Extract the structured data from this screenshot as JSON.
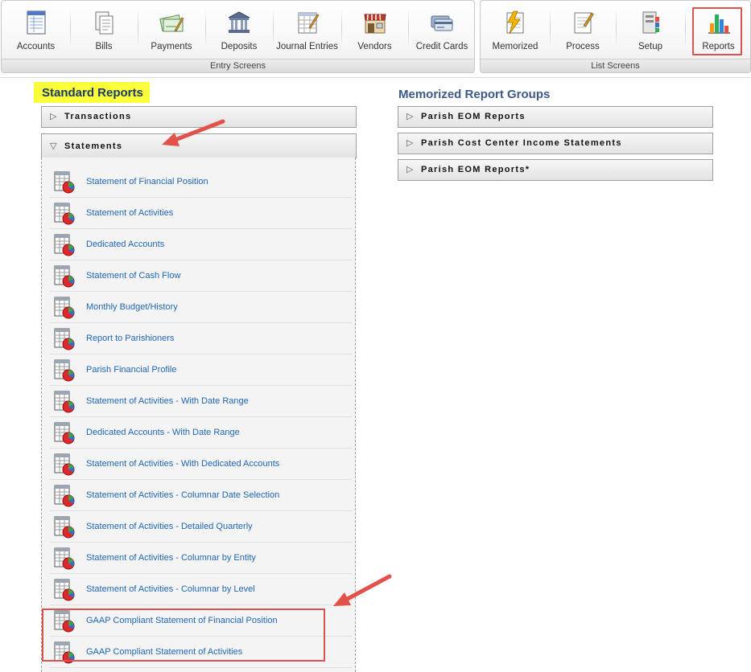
{
  "toolbar": {
    "entry_screens": {
      "section_label": "Entry Screens",
      "buttons": [
        {
          "label": "Accounts",
          "icon": "accounts-ledger-icon"
        },
        {
          "label": "Bills",
          "icon": "bills-icon"
        },
        {
          "label": "Payments",
          "icon": "payments-check-icon"
        },
        {
          "label": "Deposits",
          "icon": "bank-building-icon"
        },
        {
          "label": "Journal Entries",
          "icon": "journal-entries-icon"
        },
        {
          "label": "Vendors",
          "icon": "storefront-icon"
        },
        {
          "label": "Credit Cards",
          "icon": "credit-card-icon"
        }
      ]
    },
    "list_screens": {
      "section_label": "List Screens",
      "buttons": [
        {
          "label": "Memorized",
          "icon": "memorized-lightning-icon"
        },
        {
          "label": "Process",
          "icon": "process-document-icon"
        },
        {
          "label": "Setup",
          "icon": "setup-icon"
        },
        {
          "label": "Reports",
          "icon": "bar-chart-icon",
          "selected": true
        }
      ]
    }
  },
  "standard_reports": {
    "title": "Standard Reports",
    "groups": [
      {
        "label": "Transactions",
        "expanded": false
      },
      {
        "label": "Statements",
        "expanded": true
      }
    ],
    "statements": [
      "Statement of Financial Position",
      "Statement of Activities",
      "Dedicated Accounts",
      "Statement of Cash Flow",
      "Monthly Budget/History",
      "Report to Parishioners",
      "Parish Financial Profile",
      "Statement of Activities - With Date Range",
      "Dedicated Accounts - With Date Range",
      "Statement of Activities - With Dedicated Accounts",
      "Statement of Activities - Columnar Date Selection",
      "Statement of Activities - Detailed Quarterly",
      "Statement of Activities - Columnar by Entity",
      "Statement of Activities - Columnar by Level",
      "GAAP Compliant Statement of Financial Position",
      "GAAP Compliant Statement of Activities"
    ]
  },
  "memorized_report_groups": {
    "title": "Memorized Report Groups",
    "groups": [
      {
        "label": "Parish EOM Reports"
      },
      {
        "label": "Parish Cost Center Income Statements"
      },
      {
        "label": "Parish EOM Reports*"
      }
    ]
  },
  "glyphs": {
    "collapsed": "▷",
    "expanded": "▽"
  },
  "colors": {
    "highlight_yellow": "#fafd3a",
    "annotation_red": "#d9534f",
    "link_blue": "#1f66b4",
    "heading_navy": "#3d5a86"
  }
}
